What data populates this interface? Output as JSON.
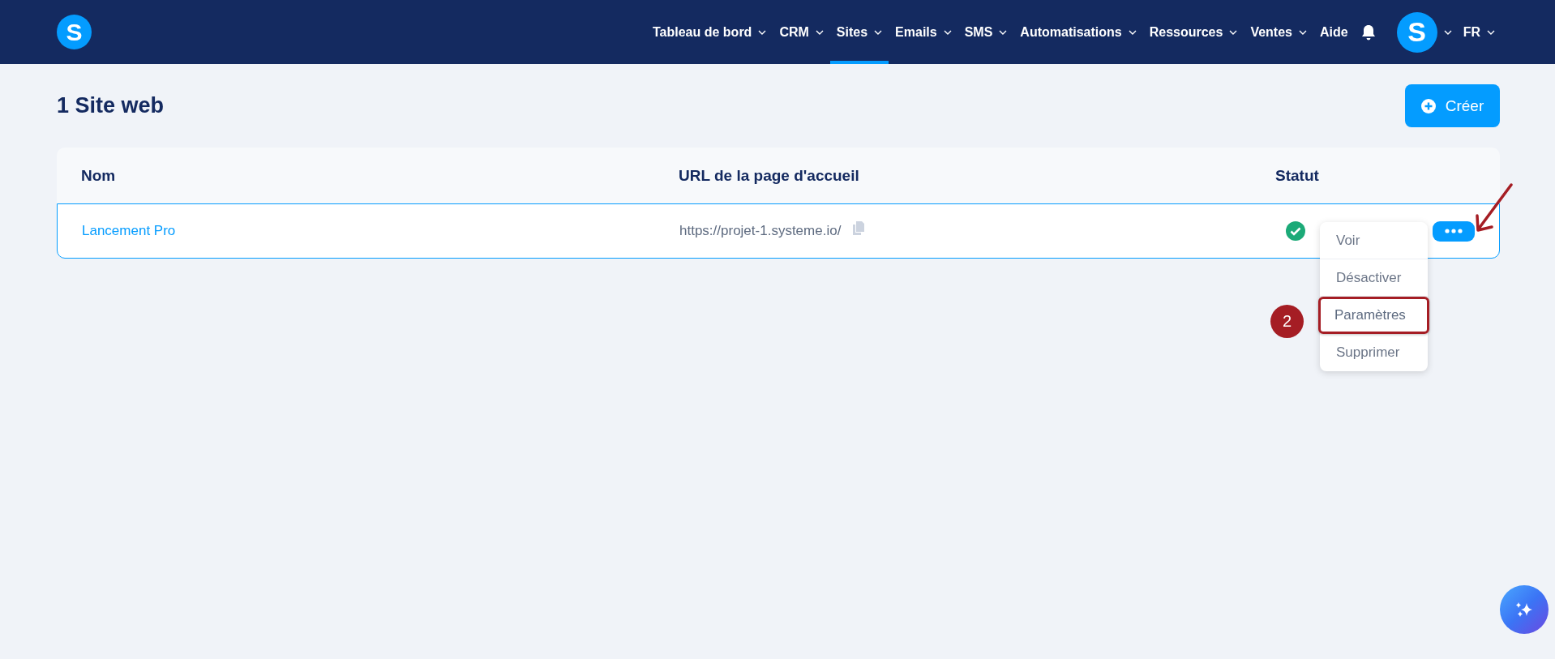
{
  "nav": {
    "items": [
      {
        "label": "Tableau de bord",
        "dropdown": true,
        "selected": false
      },
      {
        "label": "CRM",
        "dropdown": true,
        "selected": false
      },
      {
        "label": "Sites",
        "dropdown": true,
        "selected": true
      },
      {
        "label": "Emails",
        "dropdown": true,
        "selected": false
      },
      {
        "label": "SMS",
        "dropdown": true,
        "selected": false
      },
      {
        "label": "Automatisations",
        "dropdown": true,
        "selected": false
      },
      {
        "label": "Ressources",
        "dropdown": true,
        "selected": false
      },
      {
        "label": "Ventes",
        "dropdown": true,
        "selected": false
      },
      {
        "label": "Aide",
        "dropdown": false,
        "selected": false
      }
    ],
    "logo": "S",
    "avatar": "S",
    "language": "FR"
  },
  "page": {
    "title": "1 Site web",
    "create_button": "Créer"
  },
  "table": {
    "columns": [
      "Nom",
      "URL de la page d'accueil",
      "Statut"
    ],
    "rows": [
      {
        "name": "Lancement Pro",
        "url": "https://projet-1.systeme.io/",
        "active": true,
        "selected": true
      }
    ]
  },
  "row_menu": {
    "items": [
      {
        "label": "Voir",
        "highlighted": false
      },
      {
        "label": "Désactiver",
        "highlighted": false
      },
      {
        "label": "Paramètres",
        "highlighted": true
      },
      {
        "label": "Supprimer",
        "highlighted": false
      }
    ]
  },
  "annotation": {
    "step": "2"
  }
}
